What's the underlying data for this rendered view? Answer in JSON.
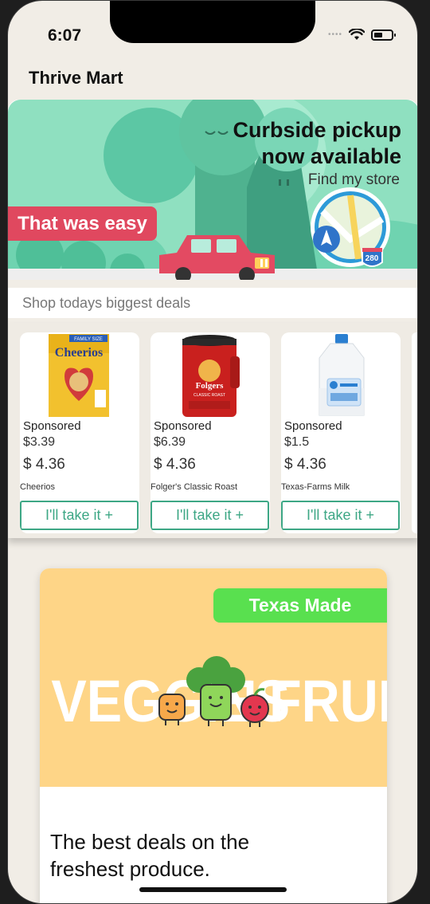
{
  "status_bar": {
    "time": "6:07",
    "signal_dots": "••••"
  },
  "header": {
    "title": "Thrive Mart"
  },
  "hero": {
    "title_line1": "Curbside pickup",
    "title_line2": "now available",
    "link": "Find my store",
    "badge": "That was easy",
    "route_sign": "280"
  },
  "deals": {
    "label": "Shop todays biggest deals"
  },
  "products": [
    {
      "sponsored": "Sponsored",
      "price": "$3.39",
      "price_alt": "$ 4.36",
      "name": "Cheerios",
      "button": "I'll take it +",
      "package_text": "Cheerios",
      "package_top": "FAMILY SIZE"
    },
    {
      "sponsored": "Sponsored",
      "price": "$6.39",
      "price_alt": "$ 4.36",
      "name": "Folger's Classic Roast",
      "button": "I'll take it +",
      "package_text": "Folgers",
      "package_sub": "CLASSIC ROAST"
    },
    {
      "sponsored": "Sponsored",
      "price": "$1.5",
      "price_alt": "$ 4.36",
      "name": "Texas-Farms Milk",
      "button": "I'll take it +"
    }
  ],
  "feature": {
    "badge": "Texas Made",
    "art_word_left": "VEGGIES",
    "art_word_mid": "'N",
    "art_word_right": "FRUIT",
    "text": "The best deals on the freshest produce."
  },
  "colors": {
    "background": "#f1ede6",
    "accent_green": "#3da785",
    "badge_red": "#e0485f",
    "badge_green": "#59e04f",
    "feature_yellow": "#fed587"
  }
}
